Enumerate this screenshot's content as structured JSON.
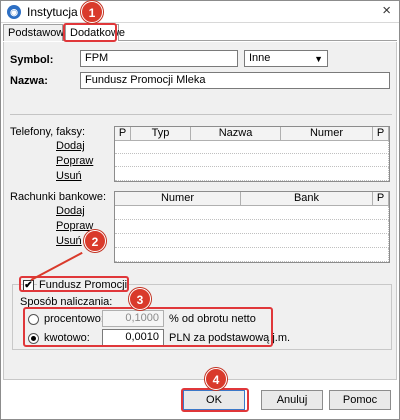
{
  "window": {
    "title": "Instytucja",
    "close": "×"
  },
  "tabs": [
    {
      "label": "Podstawowe"
    },
    {
      "label": "Dodatkowe"
    }
  ],
  "form": {
    "symbol_label": "Symbol:",
    "symbol_value": "FPM",
    "type_select": "Inne",
    "name_label": "Nazwa:",
    "name_value": "Fundusz Promocji Mleka"
  },
  "phones": {
    "label": "Telefony, faksy:",
    "actions": [
      "Dodaj",
      "Popraw",
      "Usuń"
    ],
    "columns": [
      "P",
      "Typ",
      "Nazwa",
      "Numer",
      "P"
    ]
  },
  "accounts": {
    "label": "Rachunki bankowe:",
    "actions": [
      "Dodaj",
      "Popraw",
      "Usuń"
    ],
    "columns": [
      "Numer",
      "Bank",
      "P"
    ]
  },
  "fund": {
    "checkbox_label": "Fundusz Promocji",
    "checked": true,
    "method_label": "Sposób naliczania:",
    "options": [
      {
        "label": "procentowo:",
        "value": "0,1000",
        "suffix": "% od obrotu netto",
        "selected": false
      },
      {
        "label": "kwotowo:",
        "value": "0,0010",
        "suffix": "PLN za podstawową j.m.",
        "selected": true
      }
    ]
  },
  "buttons": {
    "ok": "OK",
    "cancel": "Anuluj",
    "help": "Pomoc"
  },
  "annotations": [
    "1",
    "2",
    "3",
    "4"
  ],
  "colors": {
    "annotation_red": "#d93a2b",
    "window_bg": "#f0f0f0",
    "app_icon": "#2d6fc4"
  }
}
